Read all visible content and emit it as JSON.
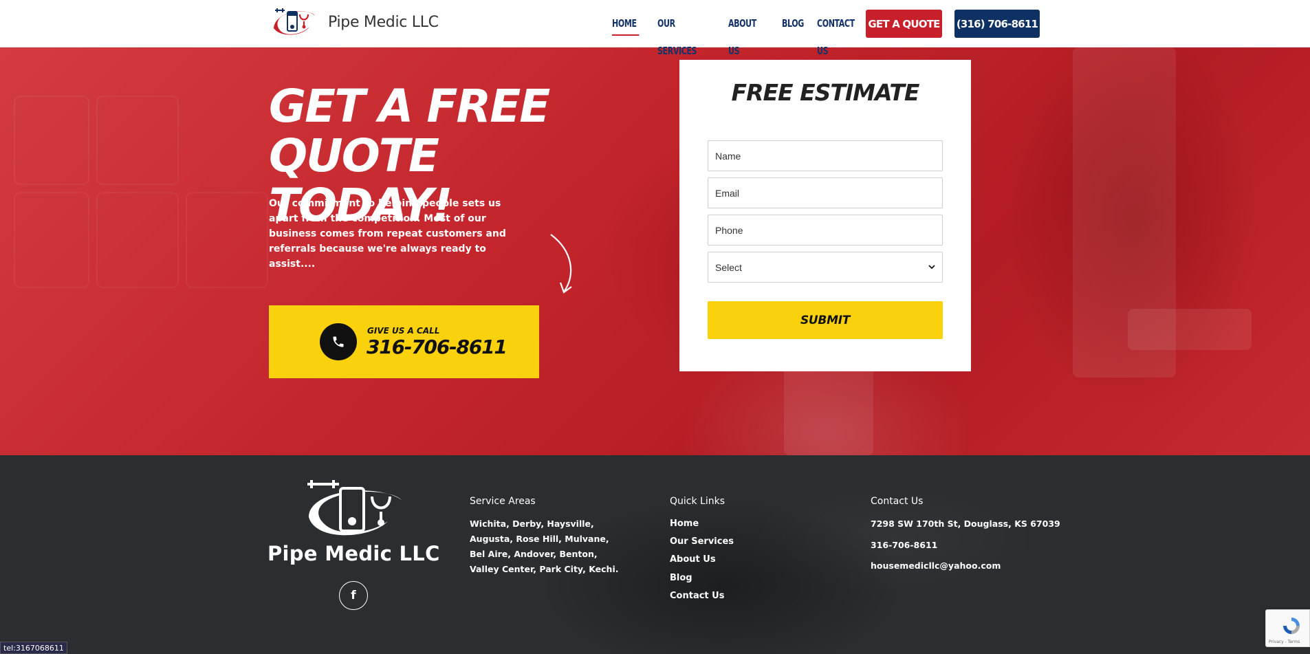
{
  "header": {
    "brand": "Pipe Medic LLC",
    "nav": [
      {
        "label": "HOME"
      },
      {
        "label": "OUR SERVICES"
      },
      {
        "label": "ABOUT US"
      },
      {
        "label": "BLOG"
      },
      {
        "label": "CONTACT US"
      }
    ],
    "quote_button": "GET A QUOTE",
    "phone_button": "(316) 706-8611"
  },
  "hero": {
    "title_line1": "GET A FREE",
    "title_line2": "QUOTE TODAY!",
    "description": "Our commitment to helping people sets us apart from the competition. Most of our business comes from repeat customers and referrals because we're always ready to assist....",
    "call_label": "GIVE US A CALL",
    "call_number": "316-706-8611",
    "icons": {
      "call": "phone-icon",
      "arrow": "curved-arrow-icon"
    }
  },
  "form": {
    "title": "FREE ESTIMATE",
    "name_placeholder": "Name",
    "email_placeholder": "Email",
    "phone_placeholder": "Phone",
    "select_value": "Select",
    "submit_label": "SUBMIT"
  },
  "footer": {
    "brand": "Pipe Medic LLC",
    "social_icon": "facebook-icon",
    "service_areas": {
      "title": "Service Areas",
      "lines": [
        "Wichita, Derby, Haysville,",
        "Augusta, Rose Hill, Mulvane,",
        "Bel Aire, Andover, Benton,",
        "Valley Center, Park City, Kechi."
      ]
    },
    "quick_links": {
      "title": "Quick Links",
      "links": [
        "Home",
        "Our Services",
        "About Us",
        "Blog",
        "Contact Us"
      ]
    },
    "contact": {
      "title": "Contact Us",
      "address": "7298 SW 170th St, Douglass, KS 67039",
      "phone": "316-706-8611",
      "email": "housemedicllc@yahoo.com"
    }
  },
  "status_bar": "tel:3167068611",
  "recaptcha": {
    "text": "Privacy - Terms"
  },
  "colors": {
    "red": "#c8202a",
    "navy": "#0f3063",
    "yellow": "#f9d10d",
    "footer_bg": "#2b2e31"
  }
}
